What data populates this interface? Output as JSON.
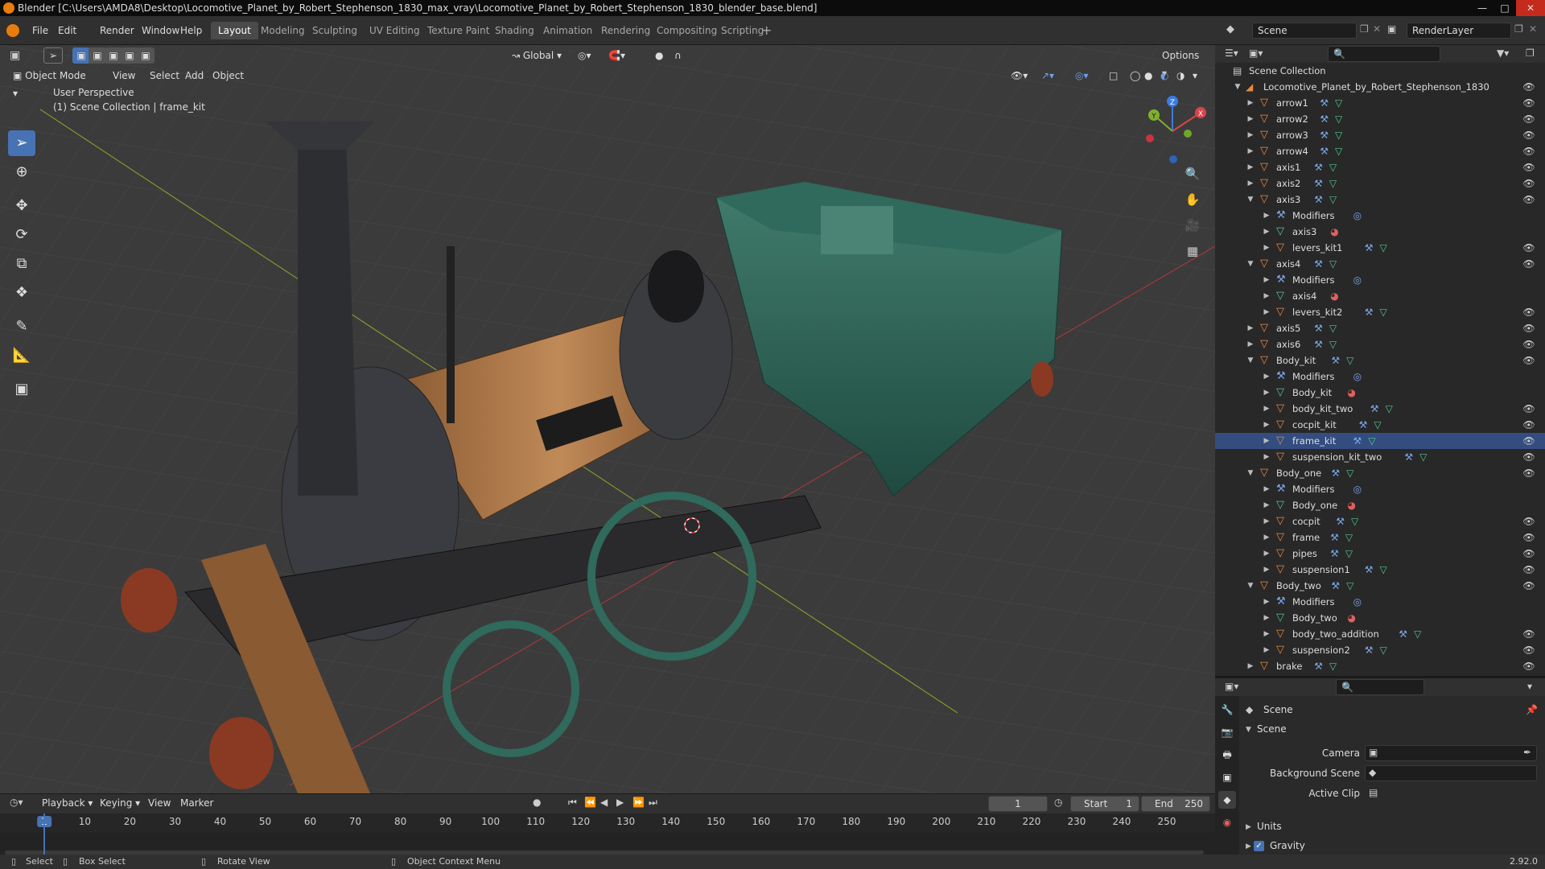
{
  "title": "Blender [C:\\Users\\AMDA8\\Desktop\\Locomotive_Planet_by_Robert_Stephenson_1830_max_vray\\Locomotive_Planet_by_Robert_Stephenson_1830_blender_base.blend]",
  "menus": [
    "File",
    "Edit",
    "Render",
    "Window",
    "Help"
  ],
  "workspaces": [
    "Layout",
    "Modeling",
    "Sculpting",
    "UV Editing",
    "Texture Paint",
    "Shading",
    "Animation",
    "Rendering",
    "Compositing",
    "Scripting"
  ],
  "active_workspace": "Layout",
  "scene_field": "Scene",
  "view_layer_field": "RenderLayer",
  "viewport": {
    "mode": "Object Mode",
    "header_menus": [
      "View",
      "Select",
      "Add",
      "Object"
    ],
    "transform_orientation": "Global",
    "options_label": "Options",
    "perspective_label": "User Perspective",
    "collection_label": "(1) Scene Collection | frame_kit",
    "gizmo_axes": {
      "x": "X",
      "y": "Y",
      "z": "Z"
    }
  },
  "outliner": {
    "root": "Scene Collection",
    "collection": "Locomotive_Planet_by_Robert_Stephenson_1830",
    "rows": [
      {
        "label": "arrow1",
        "depth": 1,
        "type": "obj",
        "expanded": false,
        "eye": true
      },
      {
        "label": "arrow2",
        "depth": 1,
        "type": "obj",
        "expanded": false,
        "eye": true
      },
      {
        "label": "arrow3",
        "depth": 1,
        "type": "obj",
        "expanded": false,
        "eye": true
      },
      {
        "label": "arrow4",
        "depth": 1,
        "type": "obj",
        "expanded": false,
        "eye": true
      },
      {
        "label": "axis1",
        "depth": 1,
        "type": "obj",
        "expanded": false,
        "eye": true
      },
      {
        "label": "axis2",
        "depth": 1,
        "type": "obj",
        "expanded": false,
        "eye": true
      },
      {
        "label": "axis3",
        "depth": 1,
        "type": "obj",
        "expanded": true,
        "eye": true
      },
      {
        "label": "Modifiers",
        "depth": 2,
        "type": "mod",
        "expanded": false,
        "eye": false
      },
      {
        "label": "axis3",
        "depth": 2,
        "type": "mesh",
        "expanded": false,
        "eye": false
      },
      {
        "label": "levers_kit1",
        "depth": 2,
        "type": "obj",
        "expanded": false,
        "eye": true
      },
      {
        "label": "axis4",
        "depth": 1,
        "type": "obj",
        "expanded": true,
        "eye": true
      },
      {
        "label": "Modifiers",
        "depth": 2,
        "type": "mod",
        "expanded": false,
        "eye": false
      },
      {
        "label": "axis4",
        "depth": 2,
        "type": "mesh",
        "expanded": false,
        "eye": false
      },
      {
        "label": "levers_kit2",
        "depth": 2,
        "type": "obj",
        "expanded": false,
        "eye": true
      },
      {
        "label": "axis5",
        "depth": 1,
        "type": "obj",
        "expanded": false,
        "eye": true
      },
      {
        "label": "axis6",
        "depth": 1,
        "type": "obj",
        "expanded": false,
        "eye": true
      },
      {
        "label": "Body_kit",
        "depth": 1,
        "type": "obj",
        "expanded": true,
        "eye": true
      },
      {
        "label": "Modifiers",
        "depth": 2,
        "type": "mod",
        "expanded": false,
        "eye": false
      },
      {
        "label": "Body_kit",
        "depth": 2,
        "type": "mesh",
        "expanded": false,
        "eye": false
      },
      {
        "label": "body_kit_two",
        "depth": 2,
        "type": "obj",
        "expanded": false,
        "eye": true
      },
      {
        "label": "cocpit_kit",
        "depth": 2,
        "type": "obj",
        "expanded": false,
        "eye": true
      },
      {
        "label": "frame_kit",
        "depth": 2,
        "type": "obj",
        "expanded": false,
        "eye": true,
        "selected": true
      },
      {
        "label": "suspension_kit_two",
        "depth": 2,
        "type": "obj",
        "expanded": false,
        "eye": true
      },
      {
        "label": "Body_one",
        "depth": 1,
        "type": "obj",
        "expanded": true,
        "eye": true
      },
      {
        "label": "Modifiers",
        "depth": 2,
        "type": "mod",
        "expanded": false,
        "eye": false
      },
      {
        "label": "Body_one",
        "depth": 2,
        "type": "mesh",
        "expanded": false,
        "eye": false
      },
      {
        "label": "cocpit",
        "depth": 2,
        "type": "obj",
        "expanded": false,
        "eye": true
      },
      {
        "label": "frame",
        "depth": 2,
        "type": "obj",
        "expanded": false,
        "eye": true
      },
      {
        "label": "pipes",
        "depth": 2,
        "type": "obj",
        "expanded": false,
        "eye": true
      },
      {
        "label": "suspension1",
        "depth": 2,
        "type": "obj",
        "expanded": false,
        "eye": true
      },
      {
        "label": "Body_two",
        "depth": 1,
        "type": "obj",
        "expanded": true,
        "eye": true
      },
      {
        "label": "Modifiers",
        "depth": 2,
        "type": "mod",
        "expanded": false,
        "eye": false
      },
      {
        "label": "Body_two",
        "depth": 2,
        "type": "mesh",
        "expanded": false,
        "eye": false
      },
      {
        "label": "body_two_addition",
        "depth": 2,
        "type": "obj",
        "expanded": false,
        "eye": true
      },
      {
        "label": "suspension2",
        "depth": 2,
        "type": "obj",
        "expanded": false,
        "eye": true
      },
      {
        "label": "brake",
        "depth": 1,
        "type": "obj",
        "expanded": false,
        "eye": true
      }
    ]
  },
  "properties": {
    "context": "Scene",
    "panel": "Scene",
    "fields": [
      {
        "label": "Camera"
      },
      {
        "label": "Background Scene"
      },
      {
        "label": "Active Clip"
      }
    ],
    "subpanels": [
      "Units",
      "Gravity"
    ],
    "gravity_checked": true
  },
  "timeline": {
    "menus": [
      "Playback",
      "Keying",
      "View",
      "Marker"
    ],
    "current_frame": "1",
    "start_label": "Start",
    "start": "1",
    "end_label": "End",
    "end": "250",
    "ticks": [
      "1",
      "10",
      "20",
      "30",
      "40",
      "50",
      "60",
      "70",
      "80",
      "90",
      "100",
      "110",
      "120",
      "130",
      "140",
      "150",
      "160",
      "170",
      "180",
      "190",
      "200",
      "210",
      "220",
      "230",
      "240",
      "250"
    ]
  },
  "statusbar": {
    "items": [
      "Select",
      "Box Select",
      "Rotate View",
      "Object Context Menu"
    ],
    "version": "2.92.0"
  },
  "colors": {
    "accent": "#4772b3",
    "object_icon": "#e88a3a",
    "mesh_icon": "#4fc98b",
    "modifier_icon": "#7aa6e8",
    "material_icon": "#e06060"
  }
}
